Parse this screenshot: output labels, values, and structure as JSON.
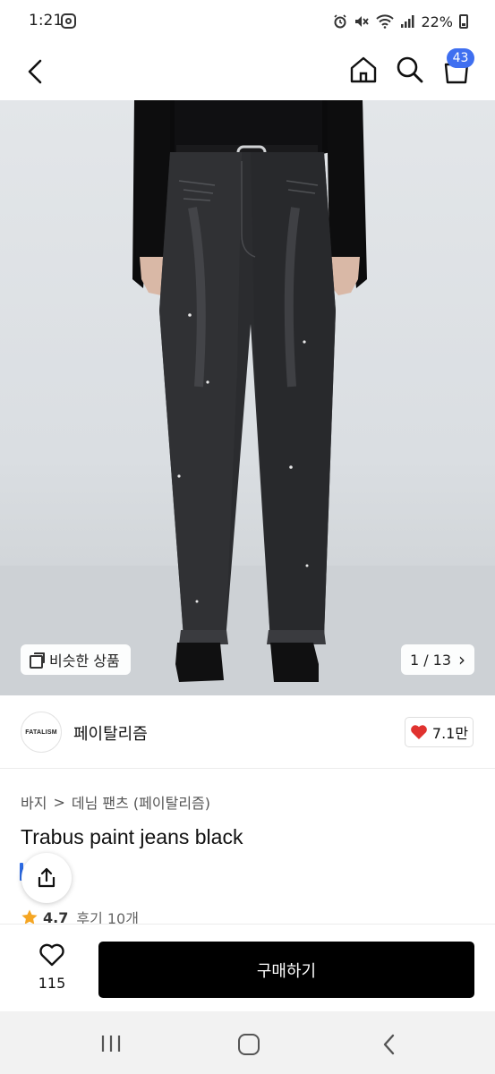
{
  "status_bar": {
    "time": "1:21",
    "battery": "22%",
    "icons": [
      "instagram-icon",
      "alarm-icon",
      "mute-icon",
      "wifi-icon",
      "signal-icon",
      "battery-icon"
    ]
  },
  "app_bar": {
    "icons": [
      "back-arrow-icon",
      "home-icon",
      "search-icon",
      "cart-icon"
    ],
    "cart_count": "43"
  },
  "hero": {
    "similar_label": "비슷한 상품",
    "page_indicator": "1 / 13",
    "chevron": "›"
  },
  "brand": {
    "logo_text": "FATALISM",
    "name": "페이탈리즘",
    "likes": "7.1만",
    "heart_color": "#e0322f"
  },
  "product": {
    "breadcrumb": [
      "바지",
      "데님 팬츠 (페이탈리즘)"
    ],
    "breadcrumb_separator": ">",
    "title": "Trabus paint jeans black",
    "rating": "4.7",
    "reviews": "후기 10개",
    "star_color": "#f5a623"
  },
  "purchase_bar": {
    "wish_count": "115",
    "buy_label": "구매하기",
    "button_color": "#000000"
  },
  "nav_bar": {
    "icons": [
      "recent-apps-icon",
      "home-circle-icon",
      "back-chevron-icon"
    ]
  },
  "accent_color": "#3f6ff0"
}
